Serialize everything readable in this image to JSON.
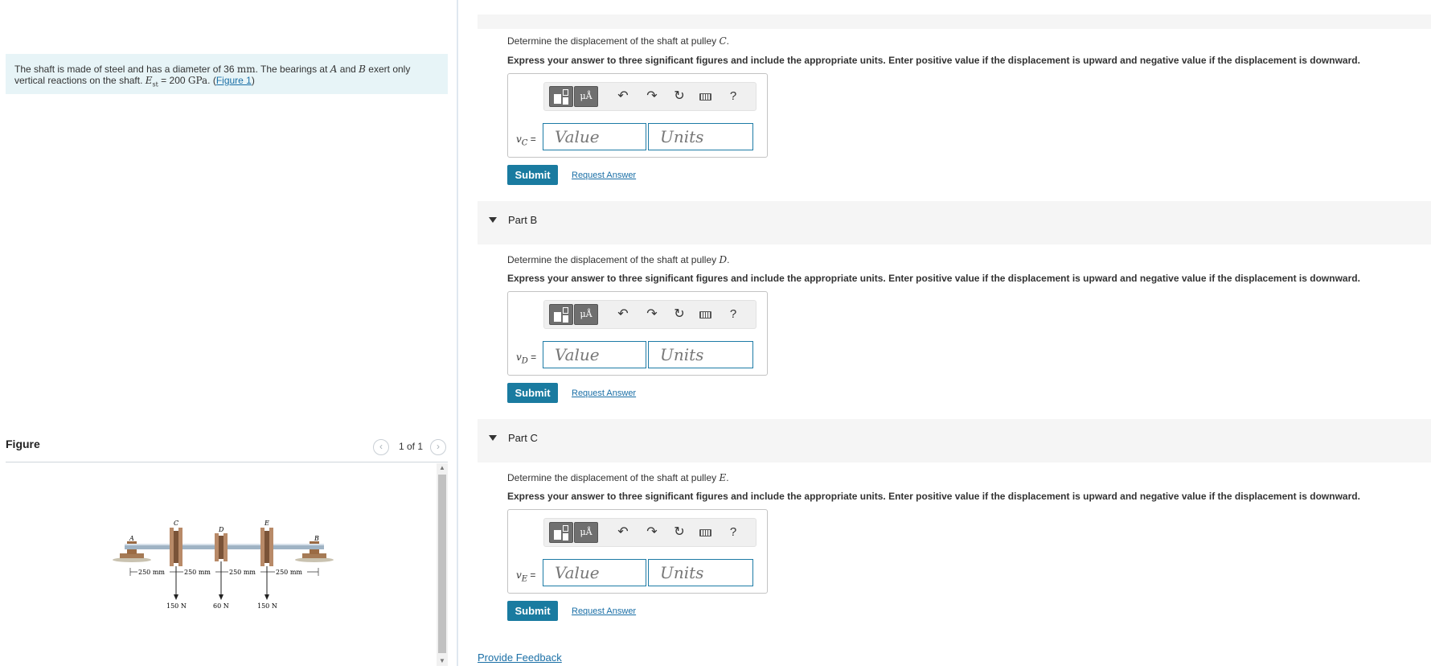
{
  "intro": {
    "pre1": "The shaft is made of steel and has a diameter of 36 ",
    "unit_mm": "mm",
    "pre2": ". The bearings at ",
    "A": "A",
    "and": " and ",
    "B": "B",
    "pre3": " exert only vertical reactions on the shaft. ",
    "E": "E",
    "st": "st",
    "eq": " = 200 ",
    "gpa": "GPa",
    "dot": ". (",
    "fig_link": "Figure 1",
    "close": ")"
  },
  "figure": {
    "title": "Figure",
    "count": "1 of 1",
    "prev": "‹",
    "next": "›",
    "labels": {
      "A": "A",
      "B": "B",
      "C": "C",
      "D": "D",
      "E": "E"
    },
    "dims": [
      "250 mm",
      "250 mm",
      "250 mm",
      "250 mm"
    ],
    "loads": [
      "150 N",
      "60 N",
      "150 N"
    ]
  },
  "toolbar": {
    "mu": "μÅ",
    "undo": "↶",
    "redo": "↷",
    "reset": "↻",
    "help": "?"
  },
  "parts": [
    {
      "label": "",
      "q_pre": "Determine the displacement of the shaft at pulley ",
      "q_var": "C",
      "q_post": ".",
      "instr": "Express your answer to three significant figures and include the appropriate units. Enter positive value if the displacement is upward and negative value if the displacement is downward.",
      "var": "v",
      "sub": "C",
      "eq": " =",
      "value_ph": "Value",
      "units_ph": "Units",
      "submit": "Submit",
      "request": "Request Answer"
    },
    {
      "label": "Part B",
      "q_pre": "Determine the displacement of the shaft at pulley ",
      "q_var": "D",
      "q_post": ".",
      "instr": "Express your answer to three significant figures and include the appropriate units. Enter positive value if the displacement is upward and negative value if the displacement is downward.",
      "var": "v",
      "sub": "D",
      "eq": " =",
      "value_ph": "Value",
      "units_ph": "Units",
      "submit": "Submit",
      "request": "Request Answer"
    },
    {
      "label": "Part C",
      "q_pre": "Determine the displacement of the shaft at pulley ",
      "q_var": "E",
      "q_post": ".",
      "instr": "Express your answer to three significant figures and include the appropriate units. Enter positive value if the displacement is upward and negative value if the displacement is downward.",
      "var": "v",
      "sub": "E",
      "eq": " =",
      "value_ph": "Value",
      "units_ph": "Units",
      "submit": "Submit",
      "request": "Request Answer"
    }
  ],
  "feedback": "Provide Feedback"
}
